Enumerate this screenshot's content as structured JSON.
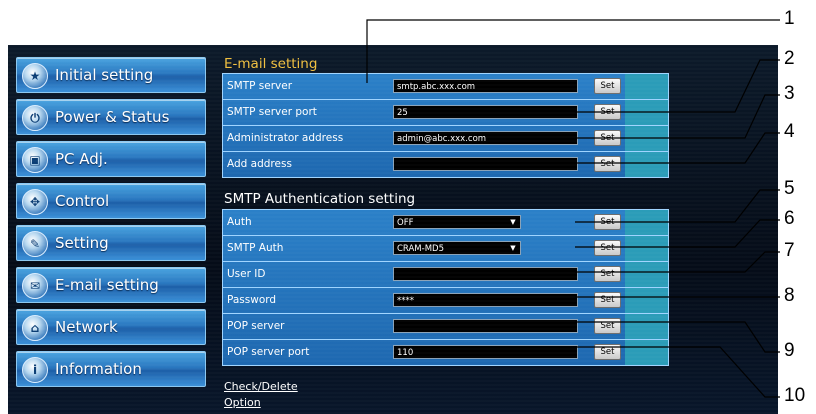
{
  "sidebar": {
    "items": [
      {
        "label": "Initial setting",
        "icon": "initial-setting-icon",
        "glyph": "★"
      },
      {
        "label": "Power & Status",
        "icon": "power-status-icon",
        "glyph": "⏻"
      },
      {
        "label": "PC Adj.",
        "icon": "pc-adj-icon",
        "glyph": "▣"
      },
      {
        "label": "Control",
        "icon": "control-icon",
        "glyph": "✥"
      },
      {
        "label": "Setting",
        "icon": "setting-icon",
        "glyph": "✎"
      },
      {
        "label": "E-mail setting",
        "icon": "email-icon",
        "glyph": "✉"
      },
      {
        "label": "Network",
        "icon": "network-icon",
        "glyph": "⌂"
      },
      {
        "label": "Information",
        "icon": "information-icon",
        "glyph": "i"
      }
    ]
  },
  "email": {
    "title": "E-mail setting",
    "rows": [
      {
        "label": "SMTP server",
        "value": "smtp.abc.xxx.com",
        "button": "Set"
      },
      {
        "label": "SMTP server port",
        "value": "25",
        "button": "Set"
      },
      {
        "label": "Administrator address",
        "value": "admin@abc.xxx.com",
        "button": "Set"
      },
      {
        "label": "Add address",
        "value": "",
        "button": "Set"
      }
    ]
  },
  "smtp": {
    "title": "SMTP Authentication setting",
    "rows": [
      {
        "label": "Auth",
        "value": "OFF",
        "type": "select",
        "button": "Set"
      },
      {
        "label": "SMTP Auth",
        "value": "CRAM-MD5",
        "type": "select",
        "button": "Set"
      },
      {
        "label": "User ID",
        "value": "",
        "type": "input",
        "button": "Set"
      },
      {
        "label": "Password",
        "value": "****",
        "type": "input",
        "button": "Set"
      },
      {
        "label": "POP server",
        "value": "",
        "type": "input",
        "button": "Set"
      },
      {
        "label": "POP server port",
        "value": "110",
        "type": "input",
        "button": "Set"
      }
    ]
  },
  "links": {
    "check_delete": "Check/Delete",
    "option": "Option"
  },
  "callouts": [
    "1",
    "2",
    "3",
    "4",
    "5",
    "6",
    "7",
    "8",
    "9",
    "10"
  ],
  "colors": {
    "section_title_email": "#f0c040",
    "panel_blue": "#2b80c8",
    "teal_strip": "#2b9cb8"
  }
}
